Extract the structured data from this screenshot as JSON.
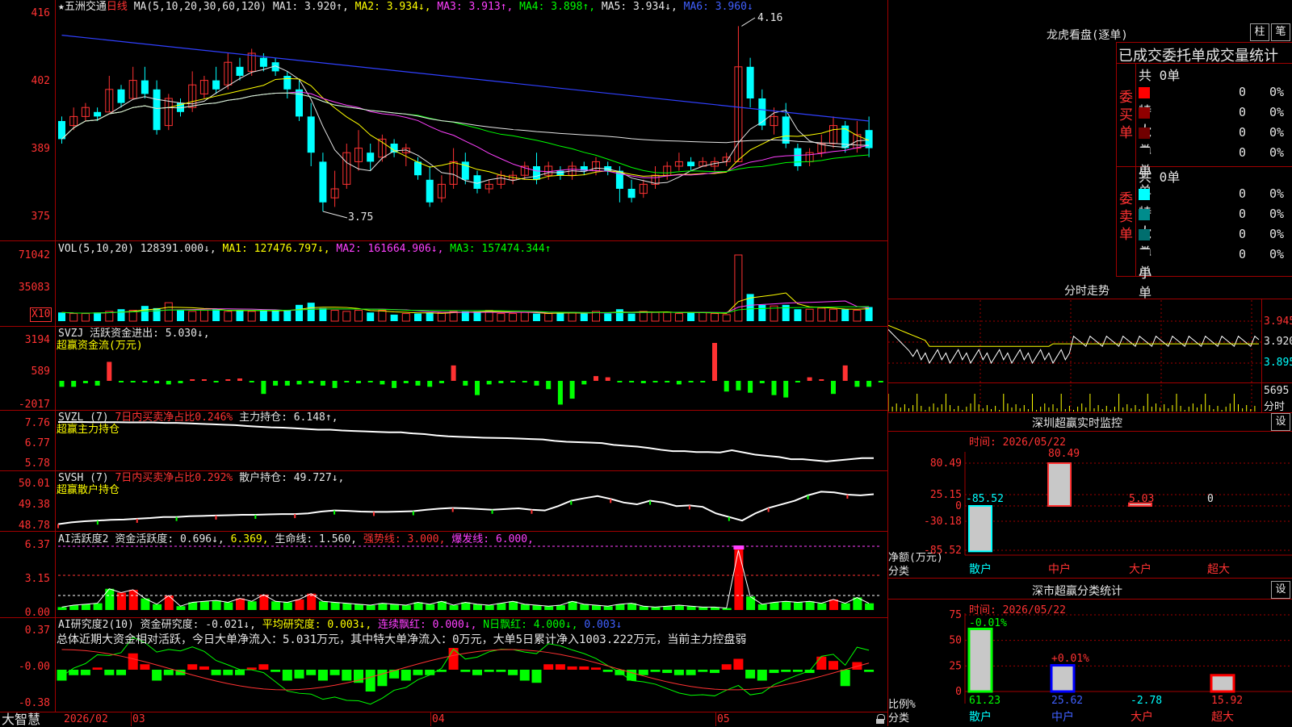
{
  "colors": {
    "up": "#ff3232",
    "down": "#00ffff",
    "axis": "#ff3232",
    "grid": "#a00000",
    "ma1": "#e6e6e6",
    "ma2": "#ffff00",
    "ma3": "#ff40ff",
    "ma4": "#00ff00",
    "ma5": "#e6e6e6",
    "ma6": "#3040ff"
  },
  "main": {
    "star": "★",
    "stock": "五洲交通",
    "period": "日线",
    "ma_params": "MA(5,10,20,30,60,120)",
    "ma1": "MA1: 3.920↑,",
    "ma2": "MA2: 3.934↓,",
    "ma3": "MA3: 3.913↑,",
    "ma4": "MA4: 3.898↑,",
    "ma5": "MA5: 3.934↓,",
    "ma6": "MA6: 3.960↓",
    "hi_label": "4.16",
    "lo_label": "3.75",
    "yticks": [
      "416",
      "402",
      "389",
      "375"
    ]
  },
  "vol": {
    "title": "VOL(5,10,20)",
    "value": "128391.000↓,",
    "ma1": "MA1: 127476.797↓,",
    "ma2": "MA2: 161664.906↓,",
    "ma3": "MA3: 157474.344↑",
    "yticks": [
      "71042",
      "35083"
    ],
    "unit": "X10"
  },
  "svzj": {
    "title": "SVZJ",
    "label": "活跃资金进出: 5.030↓,",
    "sub": "超赢资金流(万元)",
    "yticks": [
      "3194",
      "589",
      "-2017"
    ]
  },
  "svzl": {
    "title": "SVZL (7)",
    "label1": "7日内买卖净占比0.246%",
    "label2": "主力持仓: 6.148↑,",
    "sub": "超赢主力持仓",
    "yticks": [
      "7.76",
      "6.77",
      "5.78"
    ]
  },
  "svsh": {
    "title": "SVSH (7)",
    "label1": "7日内买卖净占比0.292%",
    "label2": "散户持仓: 49.727↓,",
    "sub": "超赢散户持仓",
    "yticks": [
      "50.01",
      "49.38",
      "48.78"
    ]
  },
  "ai1": {
    "title": "AI活跃度2",
    "label1": "资金活跃度: 0.696↓,",
    "label2": "6.369,",
    "label3": "生命线: 1.560,",
    "label4": "强势线: 3.000,",
    "label5": "爆发线: 6.000,",
    "yticks": [
      "6.37",
      "3.15",
      "0.00"
    ]
  },
  "ai2": {
    "title": "AI研究度2(10)",
    "label1": "资金研究度: -0.021↓,",
    "label2": "平均研究度: 0.003↓,",
    "label3": "连续飘红: 0.000↓,",
    "label4": "N日飘红: 4.000↓,",
    "label5": "0.003↓",
    "summary": "总体近期大资金相对活跃，今日大单净流入：5.031万元，其中特大单净流入：0万元，大单5日累计净入1003.222万元，当前主力控盘弱",
    "yticks": [
      "0.37",
      "-0.00",
      "-0.38"
    ]
  },
  "xaxis": {
    "brand": "大智慧",
    "labels": [
      "2026/02",
      "03",
      "04",
      "05"
    ]
  },
  "right": {
    "longhu": {
      "title": "龙虎看盘(逐单)",
      "btn1": "柱",
      "btn2": "笔",
      "header": "已成交委托单成交量统计",
      "buy": {
        "side": "委买单",
        "total": "共 0单",
        "rows": [
          {
            "name": "特大",
            "n": "0",
            "p": "0%",
            "color": "#ff0000"
          },
          {
            "name": "大单",
            "n": "0",
            "p": "0%",
            "color": "#900000"
          },
          {
            "name": "中单",
            "n": "0",
            "p": "0%",
            "color": "#700000"
          },
          {
            "name": "小单",
            "n": "0",
            "p": "0%",
            "color": "#000000"
          }
        ]
      },
      "sell": {
        "side": "委卖单",
        "total": "共 0单",
        "rows": [
          {
            "name": "特大",
            "n": "0",
            "p": "0%",
            "color": "#00ffff"
          },
          {
            "name": "大单",
            "n": "0",
            "p": "0%",
            "color": "#008c8c"
          },
          {
            "name": "中单",
            "n": "0",
            "p": "0%",
            "color": "#006e6e"
          },
          {
            "name": "小单",
            "n": "0",
            "p": "0%",
            "color": "#000000"
          }
        ]
      }
    },
    "fenshi": {
      "title": "分时走势",
      "yticks": [
        "3.945",
        "3.920",
        "3.895"
      ],
      "vol": "5695",
      "vol_label": "分时"
    },
    "monitor": {
      "title": "深圳超赢实时监控",
      "btn": "设",
      "time": "时间: 2026/05/22",
      "yticks": [
        "80.49",
        "25.15",
        "0",
        "-30.18",
        "-85.52"
      ],
      "ylabel": "净额(万元)",
      "xlabel": "分类",
      "cats": [
        "散户",
        "中户",
        "大户",
        "超大"
      ],
      "values": [
        -85.52,
        80.49,
        5.03,
        0
      ],
      "value_labels": [
        "-85.52",
        "80.49",
        "5.03",
        "0"
      ]
    },
    "classify": {
      "title": "深市超赢分类统计",
      "btn": "设",
      "time": "时间: 2026/05/22",
      "yticks": [
        "75",
        "50",
        "25",
        "0"
      ],
      "ylabel": "比例%",
      "xlabel": "分类",
      "cats": [
        "散户",
        "中户",
        "大户",
        "超大"
      ],
      "values": [
        61.23,
        25.62,
        -2.78,
        15.92
      ],
      "value_labels": [
        "61.23",
        "25.62",
        "-2.78",
        "15.92"
      ],
      "top_labels": [
        "-0.01%",
        "+0.01%"
      ]
    }
  },
  "chart_data": [
    {
      "type": "candlestick",
      "title": "五洲交通 日线",
      "ylim": [
        3.7,
        4.2
      ],
      "candles": [
        [
          3.95,
          3.91,
          3.96,
          3.9
        ],
        [
          3.94,
          3.96,
          3.98,
          3.93
        ],
        [
          3.96,
          3.98,
          3.99,
          3.95
        ],
        [
          3.97,
          3.96,
          3.98,
          3.95
        ],
        [
          3.97,
          4.02,
          4.05,
          3.97
        ],
        [
          4.02,
          3.99,
          4.03,
          3.98
        ],
        [
          4.0,
          4.04,
          4.07,
          4.0
        ],
        [
          4.04,
          4.01,
          4.07,
          4.0
        ],
        [
          4.02,
          3.93,
          4.04,
          3.92
        ],
        [
          3.94,
          4.0,
          4.01,
          3.93
        ],
        [
          3.99,
          3.97,
          4.0,
          3.96
        ],
        [
          3.98,
          4.03,
          4.06,
          3.97
        ],
        [
          4.01,
          4.04,
          4.05,
          4.0
        ],
        [
          4.04,
          4.02,
          4.07,
          4.01
        ],
        [
          4.03,
          4.08,
          4.1,
          4.02
        ],
        [
          4.07,
          4.05,
          4.09,
          4.04
        ],
        [
          4.06,
          4.1,
          4.11,
          4.05
        ],
        [
          4.09,
          4.07,
          4.1,
          4.06
        ],
        [
          4.08,
          4.06,
          4.09,
          4.05
        ],
        [
          4.05,
          4.02,
          4.06,
          4.0
        ],
        [
          4.02,
          3.96,
          4.04,
          3.95
        ],
        [
          3.96,
          3.88,
          3.99,
          3.85
        ],
        [
          3.86,
          3.77,
          3.88,
          3.75
        ],
        [
          3.78,
          3.8,
          3.84,
          3.76
        ],
        [
          3.81,
          3.88,
          3.9,
          3.8
        ],
        [
          3.86,
          3.89,
          3.93,
          3.84
        ],
        [
          3.88,
          3.86,
          3.9,
          3.84
        ],
        [
          3.87,
          3.91,
          3.92,
          3.86
        ],
        [
          3.9,
          3.88,
          3.91,
          3.87
        ],
        [
          3.88,
          3.89,
          3.9,
          3.85
        ],
        [
          3.86,
          3.83,
          3.87,
          3.82
        ],
        [
          3.82,
          3.77,
          3.85,
          3.76
        ],
        [
          3.78,
          3.81,
          3.83,
          3.77
        ],
        [
          3.81,
          3.86,
          3.89,
          3.8
        ],
        [
          3.86,
          3.82,
          3.88,
          3.81
        ],
        [
          3.83,
          3.8,
          3.84,
          3.79
        ],
        [
          3.8,
          3.81,
          3.82,
          3.79
        ],
        [
          3.81,
          3.83,
          3.84,
          3.8
        ],
        [
          3.82,
          3.83,
          3.84,
          3.81
        ],
        [
          3.83,
          3.85,
          3.86,
          3.82
        ],
        [
          3.85,
          3.82,
          3.88,
          3.81
        ],
        [
          3.83,
          3.85,
          3.86,
          3.82
        ],
        [
          3.84,
          3.83,
          3.85,
          3.82
        ],
        [
          3.83,
          3.85,
          3.86,
          3.82
        ],
        [
          3.85,
          3.84,
          3.86,
          3.83
        ],
        [
          3.84,
          3.86,
          3.87,
          3.83
        ],
        [
          3.85,
          3.84,
          3.86,
          3.83
        ],
        [
          3.84,
          3.8,
          3.85,
          3.77
        ],
        [
          3.8,
          3.78,
          3.82,
          3.77
        ],
        [
          3.79,
          3.81,
          3.82,
          3.78
        ],
        [
          3.81,
          3.83,
          3.85,
          3.8
        ],
        [
          3.83,
          3.85,
          3.86,
          3.82
        ],
        [
          3.85,
          3.86,
          3.88,
          3.84
        ],
        [
          3.86,
          3.85,
          3.87,
          3.84
        ],
        [
          3.85,
          3.86,
          3.87,
          3.85
        ],
        [
          3.85,
          3.86,
          3.87,
          3.84
        ],
        [
          3.86,
          3.87,
          3.88,
          3.85
        ],
        [
          3.86,
          4.07,
          4.16,
          3.86
        ],
        [
          4.07,
          4.0,
          4.09,
          3.98
        ],
        [
          4.0,
          3.94,
          4.02,
          3.93
        ],
        [
          3.94,
          3.96,
          3.98,
          3.92
        ],
        [
          3.96,
          3.9,
          3.99,
          3.89
        ],
        [
          3.89,
          3.85,
          3.9,
          3.84
        ],
        [
          3.86,
          3.88,
          3.89,
          3.85
        ],
        [
          3.88,
          3.9,
          3.92,
          3.87
        ],
        [
          3.9,
          3.94,
          3.96,
          3.89
        ],
        [
          3.94,
          3.89,
          3.95,
          3.88
        ],
        [
          3.89,
          3.92,
          3.95,
          3.88
        ],
        [
          3.93,
          3.89,
          3.96,
          3.87
        ]
      ]
    },
    {
      "type": "bar",
      "title": "VOL(5,10,20)",
      "values": [
        8,
        7,
        7,
        8,
        9,
        11,
        10,
        14,
        12,
        17,
        10,
        9,
        10,
        11,
        9,
        10,
        9,
        10,
        10,
        10,
        15,
        17,
        12,
        10,
        9,
        10,
        8,
        10,
        6,
        7,
        7,
        8,
        8,
        9,
        9,
        9,
        10,
        7,
        7,
        8,
        7,
        7,
        8,
        8,
        7,
        9,
        7,
        11,
        7,
        9,
        8,
        8,
        7,
        8,
        8,
        7,
        6,
        61,
        25,
        15,
        14,
        15,
        11,
        11,
        12,
        11,
        11,
        10,
        13
      ],
      "ylim": [
        0,
        75000
      ]
    },
    {
      "type": "bar",
      "title": "SVZJ",
      "values": [
        -500,
        -500,
        -200,
        -400,
        1600,
        -100,
        -100,
        -100,
        -200,
        -300,
        -200,
        100,
        100,
        -100,
        100,
        200,
        -100,
        -1100,
        -400,
        -400,
        -300,
        -200,
        -400,
        -600,
        -100,
        -200,
        -100,
        -300,
        -600,
        -200,
        -400,
        -500,
        -200,
        1300,
        -400,
        -1200,
        -300,
        -200,
        -100,
        -100,
        -400,
        -700,
        -2000,
        -1500,
        -300,
        400,
        300,
        -100,
        -100,
        -200,
        -100,
        -100,
        -300,
        -100,
        -100,
        3194,
        -900,
        -800,
        -1000,
        -200,
        -1200,
        -1400,
        -100,
        300,
        100,
        -1100,
        1300,
        -500,
        -500,
        -100
      ],
      "ylim": [
        -2017,
        3194
      ]
    },
    {
      "type": "line",
      "title": "SVZL",
      "values": [
        7.76,
        7.76,
        7.76,
        7.75,
        7.75,
        7.75,
        7.74,
        7.74,
        7.74,
        7.72,
        7.72,
        7.7,
        7.68,
        7.66,
        7.64,
        7.62,
        7.58,
        7.55,
        7.52,
        7.51,
        7.48,
        7.45,
        7.42,
        7.42,
        7.38,
        7.36,
        7.34,
        7.32,
        7.3,
        7.3,
        7.25,
        7.22,
        7.16,
        7.12,
        7.1,
        7.08,
        7.06,
        7.05,
        7.04,
        7.02,
        7.0,
        6.98,
        6.92,
        6.88,
        6.86,
        6.84,
        6.82,
        6.74,
        6.7,
        6.66,
        6.6,
        6.52,
        6.46,
        6.46,
        6.42,
        6.42,
        6.4,
        6.5,
        6.4,
        6.3,
        6.25,
        6.2,
        6.1,
        6.1,
        6.05,
        6.0,
        6.05,
        6.1,
        6.15,
        6.15
      ],
      "ylim": [
        5.78,
        7.76
      ]
    },
    {
      "type": "line",
      "title": "SVSH",
      "values": [
        48.9,
        48.95,
        48.98,
        49.0,
        49.02,
        49.03,
        49.05,
        49.07,
        49.1,
        49.1,
        49.12,
        49.13,
        49.14,
        49.15,
        49.16,
        49.16,
        49.17,
        49.18,
        49.18,
        49.2,
        49.25,
        49.28,
        49.27,
        49.25,
        49.24,
        49.24,
        49.25,
        49.26,
        49.3,
        49.33,
        49.35,
        49.34,
        49.32,
        49.3,
        49.32,
        49.34,
        49.3,
        49.28,
        49.4,
        49.55,
        49.62,
        49.68,
        49.6,
        49.5,
        49.45,
        49.55,
        49.5,
        49.4,
        49.42,
        49.38,
        49.2,
        49.1,
        49.0,
        49.2,
        49.35,
        49.45,
        49.55,
        49.7,
        49.8,
        49.78,
        49.72,
        49.7,
        49.73
      ],
      "ylim": [
        48.78,
        50.01
      ]
    }
  ]
}
